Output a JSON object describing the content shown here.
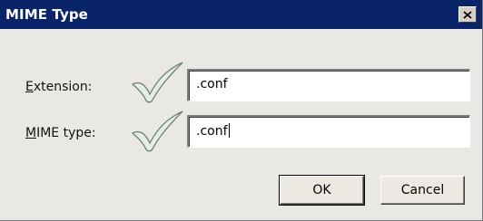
{
  "window": {
    "title": "MIME Type",
    "close_icon": "close-icon",
    "title_bar_color": "#0a246a"
  },
  "form": {
    "extension": {
      "label_mnemonic": "E",
      "label_rest": "xtension:",
      "value": ".conf",
      "valid_icon": "checkmark-icon"
    },
    "mime_type": {
      "label_mnemonic": "M",
      "label_rest": "IME type:",
      "value": ".conf",
      "valid_icon": "checkmark-icon"
    }
  },
  "buttons": {
    "ok_label": "OK",
    "cancel_label": "Cancel"
  }
}
